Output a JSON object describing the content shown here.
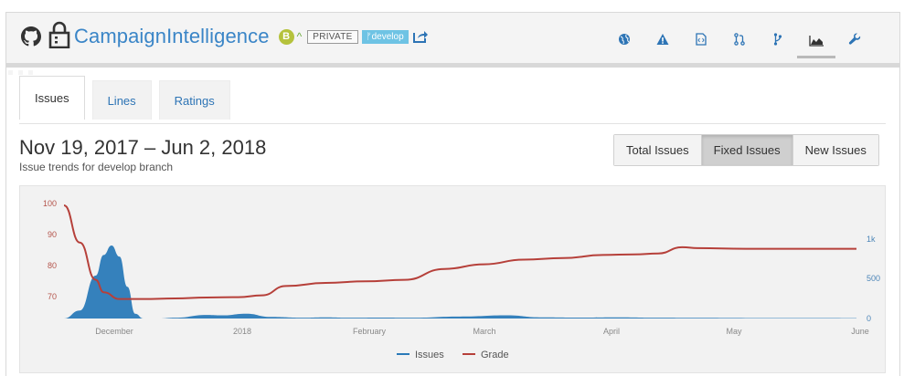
{
  "header": {
    "repo_name": "CampaignIntelligence",
    "grade": "B",
    "private_label": "PRIVATE",
    "branch_label": "develop",
    "nav_icons": [
      "globe-icon",
      "warning-icon",
      "code-file-icon",
      "pull-request-icon",
      "branch-icon",
      "chart-icon",
      "wrench-icon"
    ]
  },
  "tabs": [
    {
      "label": "Issues",
      "active": true
    },
    {
      "label": "Lines",
      "active": false
    },
    {
      "label": "Ratings",
      "active": false
    }
  ],
  "range": {
    "title": "Nov 19, 2017 – Jun 2, 2018",
    "subtitle": "Issue trends for develop branch"
  },
  "filters": [
    {
      "label": "Total Issues",
      "active": false
    },
    {
      "label": "Fixed Issues",
      "active": true
    },
    {
      "label": "New Issues",
      "active": false
    }
  ],
  "chart_data": {
    "type": "area",
    "x_ticks": [
      "December",
      "2018",
      "February",
      "March",
      "April",
      "May",
      "June"
    ],
    "y_left_ticks": [
      "100",
      "90",
      "80",
      "70"
    ],
    "y_right_ticks": [
      "1k",
      "500",
      "0"
    ],
    "legend": [
      "Issues",
      "Grade"
    ],
    "series": [
      {
        "name": "Issues",
        "axis": "right",
        "color": "#2a7ab8",
        "x": [
          0,
          0.02,
          0.04,
          0.05,
          0.06,
          0.07,
          0.08,
          0.09,
          0.1,
          0.12,
          0.14,
          0.18,
          0.2,
          0.23,
          0.26,
          0.3,
          0.33,
          0.36,
          0.4,
          0.44,
          0.5,
          0.56,
          0.6,
          0.65,
          0.7,
          0.75,
          0.8,
          0.86,
          0.92,
          1
        ],
        "values": [
          0,
          100,
          540,
          800,
          920,
          780,
          400,
          60,
          0,
          0,
          10,
          45,
          40,
          60,
          20,
          10,
          15,
          10,
          12,
          10,
          25,
          40,
          15,
          12,
          15,
          10,
          8,
          6,
          6,
          5
        ]
      },
      {
        "name": "Grade",
        "axis": "left",
        "color": "#b6403a",
        "x": [
          0,
          0.02,
          0.04,
          0.05,
          0.07,
          0.1,
          0.14,
          0.18,
          0.22,
          0.25,
          0.28,
          0.33,
          0.38,
          0.43,
          0.48,
          0.53,
          0.58,
          0.63,
          0.68,
          0.72,
          0.75,
          0.78,
          0.8,
          0.86,
          0.92,
          1
        ],
        "values": [
          100,
          88,
          76,
          72,
          69.8,
          69.8,
          70,
          70.3,
          70.4,
          71,
          74,
          75,
          75.5,
          76,
          79.5,
          81,
          82.5,
          83,
          84,
          84.2,
          84.5,
          86.5,
          86.2,
          86,
          86,
          86
        ]
      }
    ]
  }
}
